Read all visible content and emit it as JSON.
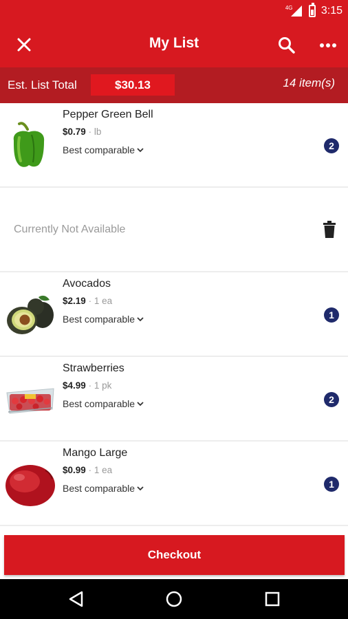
{
  "status_bar": {
    "network": "4G",
    "time": "3:15"
  },
  "app_bar": {
    "title": "My List",
    "close_icon": "close-icon",
    "search_icon": "search-icon",
    "more_icon": "more-horizontal-icon"
  },
  "summary": {
    "label": "Est. List Total",
    "total": "$30.13",
    "item_count": "14 item(s)"
  },
  "items": [
    {
      "name": "Pepper Green Bell",
      "price": "$0.79",
      "unit": "lb",
      "comparable": "Best comparable",
      "quantity": "2",
      "image": "green-bell-pepper"
    },
    {
      "unavailable_text": "Currently Not Available",
      "action_icon": "trash-icon"
    },
    {
      "name": "Avocados",
      "price": "$2.19",
      "unit": "1 ea",
      "comparable": "Best comparable",
      "quantity": "1",
      "image": "avocados"
    },
    {
      "name": "Strawberries",
      "price": "$4.99",
      "unit": "1 pk",
      "comparable": "Best comparable",
      "quantity": "2",
      "image": "strawberries"
    },
    {
      "name": "Mango Large",
      "price": "$0.99",
      "unit": "1 ea",
      "comparable": "Best comparable",
      "quantity": "1",
      "image": "mango"
    }
  ],
  "checkout": {
    "label": "Checkout"
  },
  "nav_bar": {
    "back_icon": "back-triangle-icon",
    "home_icon": "home-circle-icon",
    "recents_icon": "recents-square-icon"
  },
  "colors": {
    "primary_red": "#d71920",
    "dark_red": "#b31c22",
    "badge_navy": "#1f2a6b"
  }
}
